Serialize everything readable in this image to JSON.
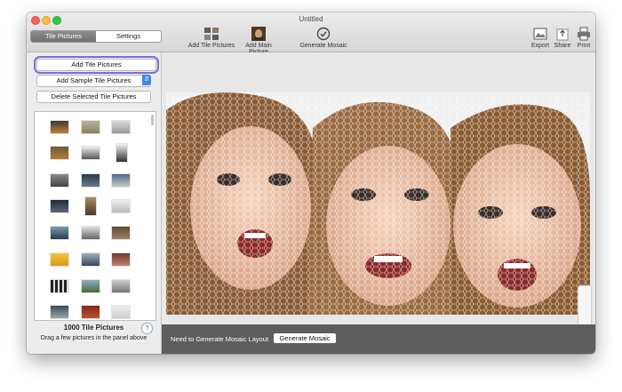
{
  "window": {
    "title": "Untitled"
  },
  "segmented": {
    "tabs": [
      {
        "label": "Tile Pictures"
      },
      {
        "label": "Settings"
      }
    ]
  },
  "toolbar": {
    "add_tile_label": "Add Tile Pictures",
    "add_main_label": "Add Main Picture",
    "generate_label": "Generate Mosaic",
    "export_label": "Export",
    "share_label": "Share",
    "print_label": "Print"
  },
  "sidebar": {
    "add_tile_button": "Add Tile Pictures",
    "add_sample_button": "Add Sample Tile Pictures",
    "delete_button": "Delete Selected Tile Pictures",
    "count": "1000 Tile Pictures",
    "hint": "Drag a few pictures in the panel above",
    "help": "?"
  },
  "status": {
    "message": "Need to Generate Mosaic Layout",
    "button": "Generate Mosaic"
  },
  "colors": {
    "accent": "#3b87f5",
    "focus_ring": "#8569d6",
    "statusbar": "#5d5d5d"
  }
}
